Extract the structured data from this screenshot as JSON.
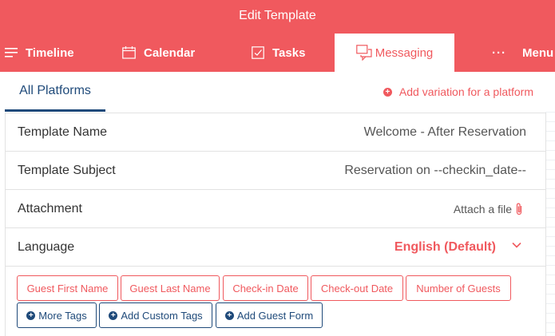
{
  "header": {
    "title": "Edit Template",
    "nav": [
      {
        "label": "Timeline",
        "icon": "list-icon"
      },
      {
        "label": "Calendar",
        "icon": "calendar-icon"
      },
      {
        "label": "Tasks",
        "icon": "checkbox-icon"
      },
      {
        "label": "Messaging",
        "icon": "chat-icon",
        "active": true
      },
      {
        "label": "Menu",
        "icon": "more-dots-icon"
      }
    ],
    "menu_dots": "···"
  },
  "platform_tabs": {
    "active_tab": "All Platforms",
    "add_variation": "Add variation for a platform",
    "add_icon_glyph": "+"
  },
  "form": {
    "template_name": {
      "label": "Template Name",
      "value": "Welcome - After Reservation"
    },
    "template_subject": {
      "label": "Template Subject",
      "value": "Reservation on --checkin_date--"
    },
    "attachment": {
      "label": "Attachment",
      "action": "Attach a file"
    },
    "language": {
      "label": "Language",
      "value": "English (Default)"
    }
  },
  "tags": [
    {
      "label": "Guest First Name"
    },
    {
      "label": "Guest Last Name"
    },
    {
      "label": "Check-in Date"
    },
    {
      "label": "Check-out Date"
    },
    {
      "label": "Number of Guests"
    }
  ],
  "actions": [
    {
      "label": "More Tags"
    },
    {
      "label": "Add Custom Tags"
    },
    {
      "label": "Add Guest Form"
    }
  ],
  "plus_glyph": "+",
  "colors": {
    "brand": "#f0595e",
    "navy": "#1f4a7a"
  }
}
